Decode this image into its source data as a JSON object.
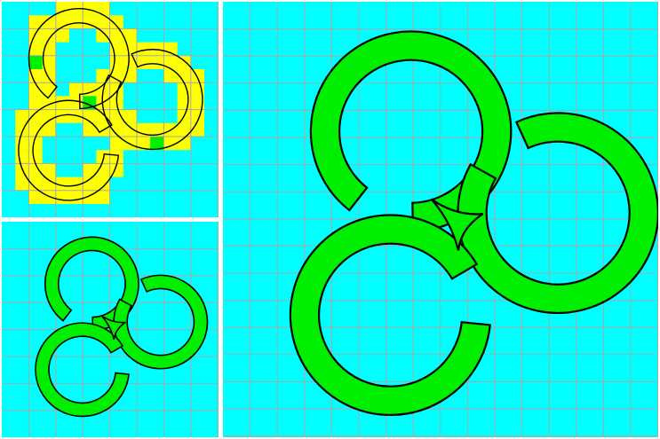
{
  "figure": {
    "description_free": true,
    "panels": [
      {
        "id": "coarse",
        "level": "coarse"
      },
      {
        "id": "fine",
        "level": "fine"
      },
      {
        "id": "detail",
        "level": "detail"
      }
    ]
  },
  "colors": {
    "background": "#00ffff",
    "fill": "#00ee00",
    "boundary_cells": "#ffff00",
    "grid": "#a8a8a8",
    "outline": "#000000",
    "divider": "#ffffff"
  }
}
